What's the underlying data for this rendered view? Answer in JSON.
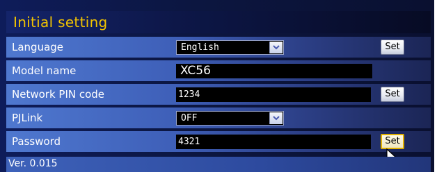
{
  "window": {
    "title": "Initial setting"
  },
  "rows": {
    "language": {
      "label": "Language",
      "value": "English",
      "button": "Set"
    },
    "model": {
      "label": "Model name",
      "value": "XC56"
    },
    "pin": {
      "label": "Network PIN code",
      "value": "1234",
      "button": "Set"
    },
    "pjlink": {
      "label": "PJLink",
      "value": "OFF"
    },
    "password": {
      "label": "Password",
      "value": "4321",
      "button": "Set"
    }
  },
  "footer": {
    "version": "Ver. 0.015"
  },
  "colors": {
    "title": "#f2c400",
    "row_blue": "#4f78cf",
    "field_bg": "#000000"
  },
  "icons": {
    "select_arrow": "chevron-down-icon",
    "pointer": "mouse-pointer-icon"
  }
}
